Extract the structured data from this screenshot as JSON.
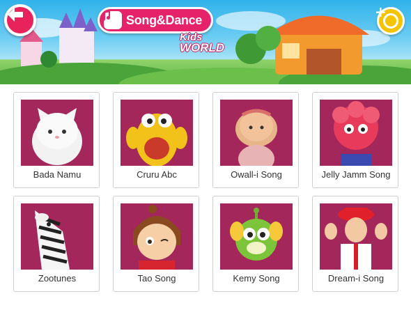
{
  "header": {
    "title": "Song&Dance",
    "logo_line1": "Kids",
    "logo_line2": "WORLD",
    "back_icon": "back-arrow-icon",
    "title_icon": "music-note-icon",
    "coin_icon": "coin-plus-icon",
    "colors": {
      "accent": "#e5226a",
      "coin": "#f5c400",
      "card_bg": "#a3275a"
    }
  },
  "cards": [
    {
      "label": "Bada Namu"
    },
    {
      "label": "Cruru Abc"
    },
    {
      "label": "Owall-i Song"
    },
    {
      "label": "Jelly Jamm Song"
    },
    {
      "label": "Zootunes"
    },
    {
      "label": "Tao Song"
    },
    {
      "label": "Kemy Song"
    },
    {
      "label": "Dream-i Song"
    }
  ]
}
